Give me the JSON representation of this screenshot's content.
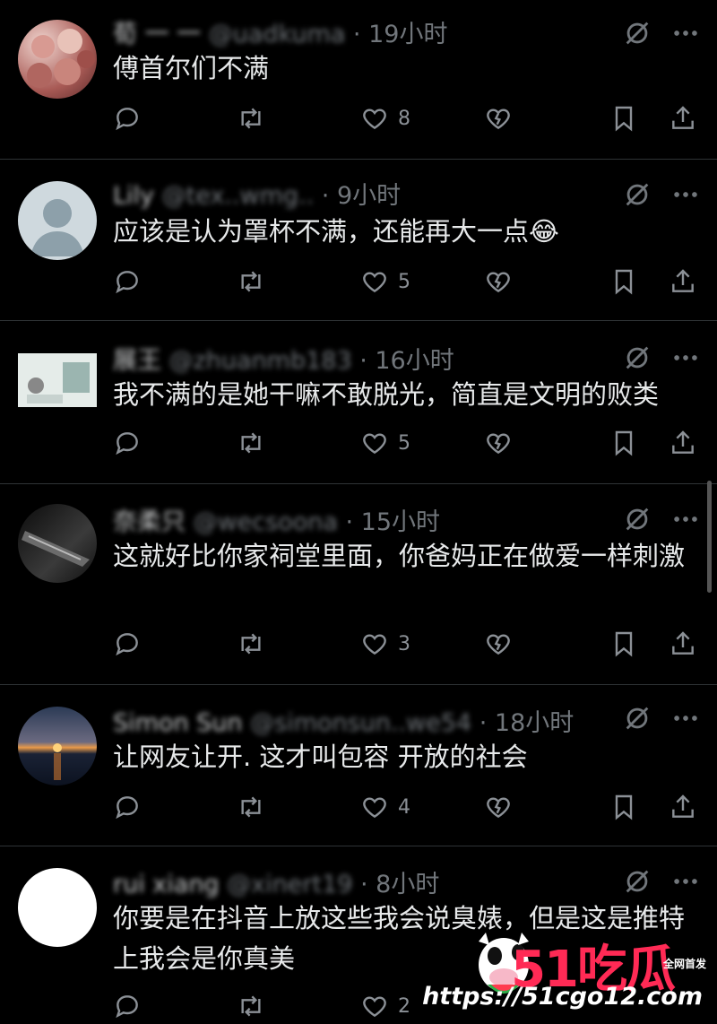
{
  "tweets": [
    {
      "name": "荀 一 一",
      "handle": "@uadkuma",
      "time": "· 19小时",
      "text": "傅首尔们不满",
      "likes": "8"
    },
    {
      "name": "Lily",
      "handle": "@tex..wmg..",
      "time": "· 9小时",
      "text": "应该是认为罩杯不满，还能再大一点😂",
      "likes": "5"
    },
    {
      "name": "展王",
      "handle": "@zhuanmb183",
      "time": "· 16小时",
      "text": "我不满的是她干嘛不敢脱光，简直是文明的败类",
      "likes": "5"
    },
    {
      "name": "奈柔只",
      "handle": "@wecsoona",
      "time": "· 15小时",
      "text": "这就好比你家祠堂里面，你爸妈正在做爱一样刺激",
      "likes": "3"
    },
    {
      "name": "Simon Sun",
      "handle": "@simonsun..we54",
      "time": "· 18小时",
      "text": "让网友让开. 这才叫包容 开放的社会",
      "likes": "4"
    },
    {
      "name": "rui xiang",
      "handle": "@xinert19",
      "time": "· 8小时",
      "text": "你要是在抖音上放这些我会说臭婊，但是这是推特上我会是你真美",
      "likes": "2"
    }
  ],
  "icons": {
    "reply": "reply-icon",
    "retweet": "retweet-icon",
    "like": "heart-icon",
    "unlike": "broken-heart-icon",
    "bookmark": "bookmark-icon",
    "share": "share-icon",
    "hide": "hide-icon",
    "more": "more-icon"
  },
  "watermark": {
    "brand": "51吃瓜",
    "sub": "全网首发",
    "url": "https://51cgo12.com"
  },
  "colors": {
    "background": "#000000",
    "text": "#e7e9ea",
    "muted": "#71767b",
    "divider": "#2f3336",
    "brand": "#ff2a55"
  }
}
